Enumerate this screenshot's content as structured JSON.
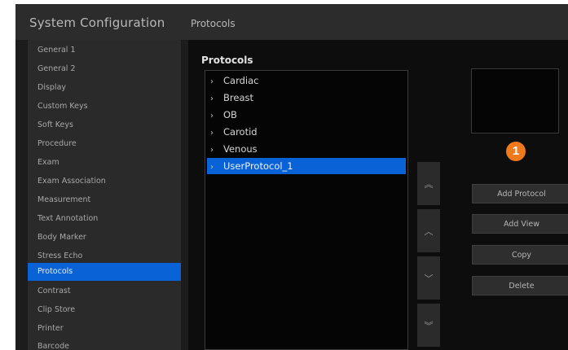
{
  "header": {
    "app_title": "System Configuration",
    "page_title": "Protocols"
  },
  "sidebar": {
    "items": [
      {
        "label": "General 1"
      },
      {
        "label": "General 2"
      },
      {
        "label": "Display"
      },
      {
        "label": "Custom Keys"
      },
      {
        "label": "Soft Keys"
      },
      {
        "label": "Procedure"
      },
      {
        "label": "Exam"
      },
      {
        "label": "Exam Association"
      },
      {
        "label": "Measurement"
      },
      {
        "label": "Text Annotation"
      },
      {
        "label": "Body Marker"
      },
      {
        "label": "Stress Echo"
      },
      {
        "label": "Protocols"
      },
      {
        "label": "Contrast"
      },
      {
        "label": "Clip Store"
      },
      {
        "label": "Printer"
      },
      {
        "label": "Barcode"
      }
    ],
    "active_item": "Protocols"
  },
  "main": {
    "section_title": "Protocols",
    "tree": [
      {
        "label": "Cardiac",
        "chevron": "›"
      },
      {
        "label": "Breast",
        "chevron": "›"
      },
      {
        "label": "OB",
        "chevron": "›"
      },
      {
        "label": "Carotid",
        "chevron": "›"
      },
      {
        "label": "Venous",
        "chevron": "›"
      },
      {
        "label": "UserProtocol_1",
        "chevron": "›"
      }
    ],
    "selected_item": "UserProtocol_1",
    "move_buttons": [
      {
        "icon": "double-chevron-up-icon",
        "glyph": "︽"
      },
      {
        "icon": "chevron-up-icon",
        "glyph": "︿"
      },
      {
        "icon": "chevron-down-icon",
        "glyph": "﹀"
      },
      {
        "icon": "double-chevron-down-icon",
        "glyph": "︾"
      }
    ],
    "badge": "1",
    "actions": {
      "add_protocol": "Add Protocol",
      "add_view": "Add View",
      "copy": "Copy",
      "delete": "Delete"
    }
  },
  "colors": {
    "accent": "#0a63d6",
    "badge": "#f07a1b",
    "background": "#1c1c1c"
  }
}
